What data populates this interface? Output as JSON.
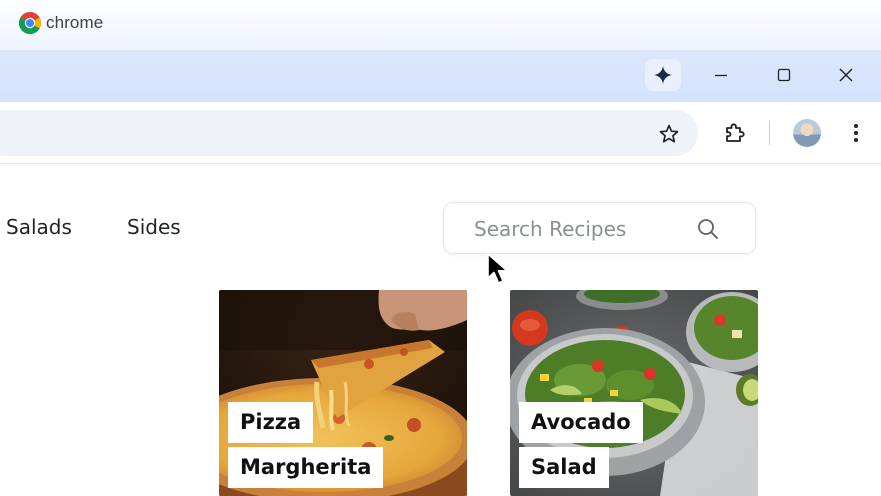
{
  "browser": {
    "brand": "chrome",
    "icons": {
      "gemini": "sparkle-icon",
      "minimize": "minimize-icon",
      "maximize": "maximize-icon",
      "close": "close-icon",
      "bookmark": "star-icon",
      "extensions": "puzzle-icon",
      "menu": "more-vert-icon"
    },
    "colors": {
      "titlebar": "#d3e2fd",
      "omnibox": "#eef2f9"
    }
  },
  "nav": {
    "links": [
      {
        "label": "Salads"
      },
      {
        "label": "Sides"
      }
    ]
  },
  "search": {
    "placeholder": "Search Recipes",
    "value": ""
  },
  "recipes": [
    {
      "line1": "Pizza",
      "line2": "Margherita"
    },
    {
      "line1": "Avocado",
      "line2": "Salad"
    }
  ]
}
